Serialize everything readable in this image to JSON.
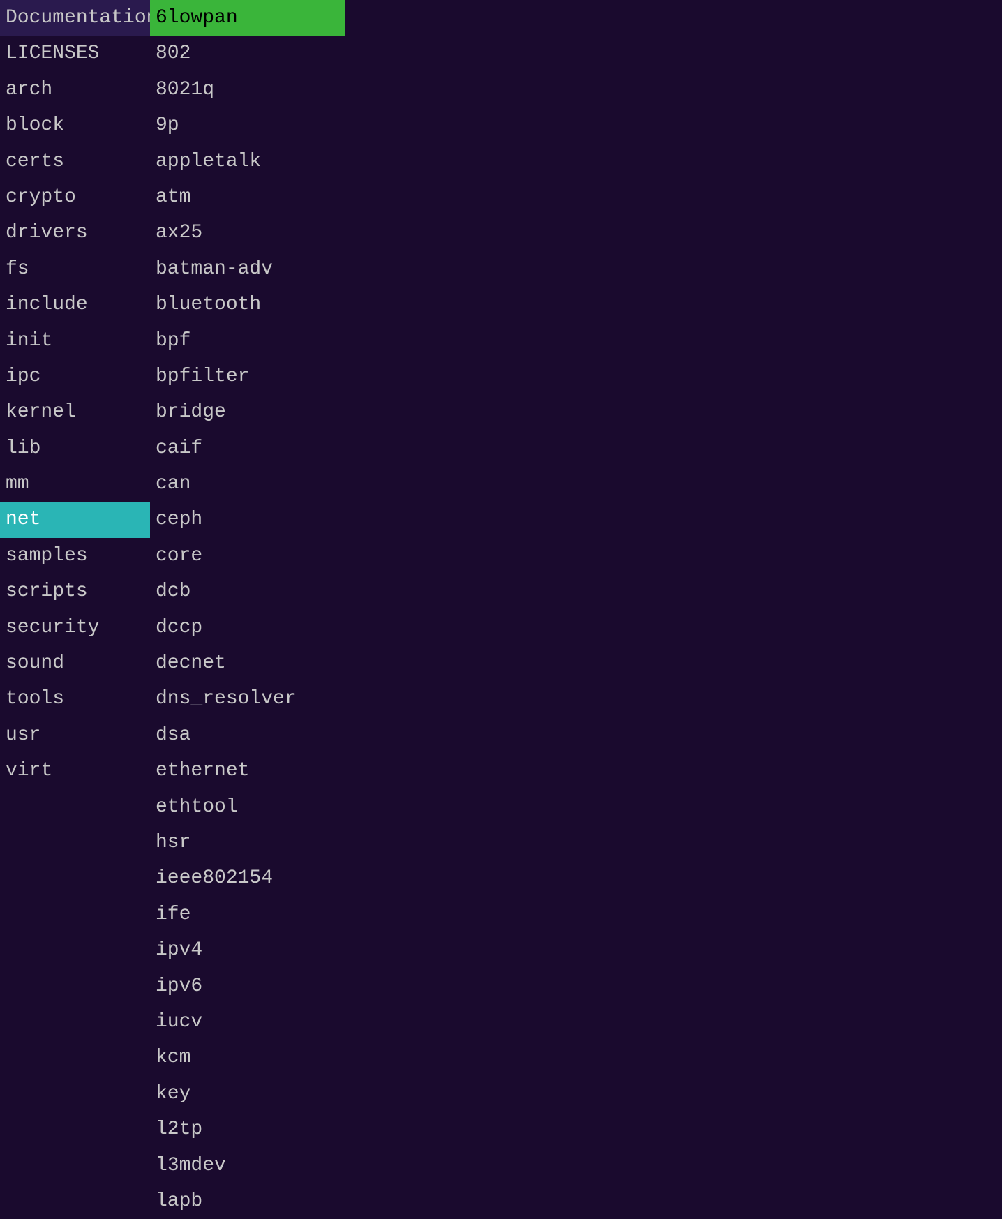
{
  "leftPanel": {
    "items": [
      {
        "label": "Documentation",
        "selected": false
      },
      {
        "label": "LICENSES",
        "selected": false
      },
      {
        "label": "arch",
        "selected": false
      },
      {
        "label": "block",
        "selected": false
      },
      {
        "label": "certs",
        "selected": false
      },
      {
        "label": "crypto",
        "selected": false
      },
      {
        "label": "drivers",
        "selected": false
      },
      {
        "label": "fs",
        "selected": false
      },
      {
        "label": "include",
        "selected": false
      },
      {
        "label": "init",
        "selected": false
      },
      {
        "label": "ipc",
        "selected": false
      },
      {
        "label": "kernel",
        "selected": false
      },
      {
        "label": "lib",
        "selected": false
      },
      {
        "label": "mm",
        "selected": false
      },
      {
        "label": "net",
        "selected": true
      },
      {
        "label": "samples",
        "selected": false
      },
      {
        "label": "scripts",
        "selected": false
      },
      {
        "label": "security",
        "selected": false
      },
      {
        "label": "sound",
        "selected": false
      },
      {
        "label": "tools",
        "selected": false
      },
      {
        "label": "usr",
        "selected": false
      },
      {
        "label": "virt",
        "selected": false
      }
    ]
  },
  "rightPanel": {
    "items": [
      {
        "label": "6lowpan",
        "selected": true
      },
      {
        "label": "802",
        "selected": false
      },
      {
        "label": "8021q",
        "selected": false
      },
      {
        "label": "9p",
        "selected": false
      },
      {
        "label": "appletalk",
        "selected": false
      },
      {
        "label": "atm",
        "selected": false
      },
      {
        "label": "ax25",
        "selected": false
      },
      {
        "label": "batman-adv",
        "selected": false
      },
      {
        "label": "bluetooth",
        "selected": false
      },
      {
        "label": "bpf",
        "selected": false
      },
      {
        "label": "bpfilter",
        "selected": false
      },
      {
        "label": "bridge",
        "selected": false
      },
      {
        "label": "caif",
        "selected": false
      },
      {
        "label": "can",
        "selected": false
      },
      {
        "label": "ceph",
        "selected": false
      },
      {
        "label": "core",
        "selected": false
      },
      {
        "label": "dcb",
        "selected": false
      },
      {
        "label": "dccp",
        "selected": false
      },
      {
        "label": "decnet",
        "selected": false
      },
      {
        "label": "dns_resolver",
        "selected": false
      },
      {
        "label": "dsa",
        "selected": false
      },
      {
        "label": "ethernet",
        "selected": false
      },
      {
        "label": "ethtool",
        "selected": false
      },
      {
        "label": "hsr",
        "selected": false
      },
      {
        "label": "ieee802154",
        "selected": false
      },
      {
        "label": "ife",
        "selected": false
      },
      {
        "label": "ipv4",
        "selected": false
      },
      {
        "label": "ipv6",
        "selected": false
      },
      {
        "label": "iucv",
        "selected": false
      },
      {
        "label": "kcm",
        "selected": false
      },
      {
        "label": "key",
        "selected": false
      },
      {
        "label": "l2tp",
        "selected": false
      },
      {
        "label": "l3mdev",
        "selected": false
      },
      {
        "label": "lapb",
        "selected": false
      }
    ]
  }
}
